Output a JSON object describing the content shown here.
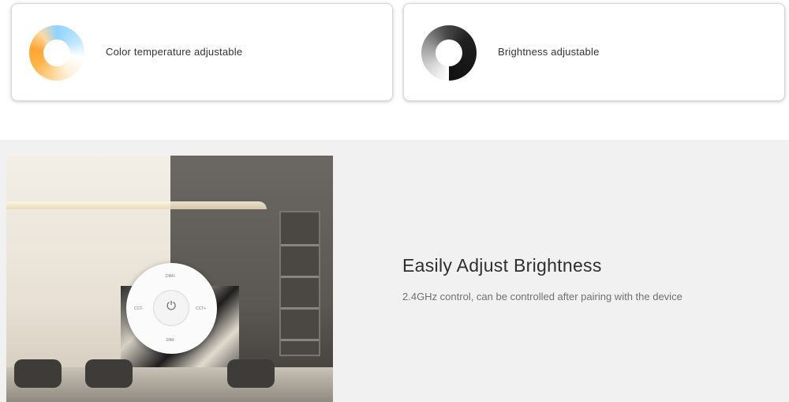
{
  "features": [
    {
      "icon": "color-temperature-ring-icon",
      "label": "Color temperature adjustable"
    },
    {
      "icon": "brightness-ring-icon",
      "label": "Brightness adjustable"
    }
  ],
  "remote": {
    "power_icon": "power-icon",
    "dim_plus": "DIM+",
    "dim_minus": "DIM-",
    "cct_minus": "CCT-",
    "cct_plus": "CCT+"
  },
  "section": {
    "title": "Easily Adjust Brightness",
    "subtitle": "2.4GHz control, can be controlled after pairing with the device"
  }
}
